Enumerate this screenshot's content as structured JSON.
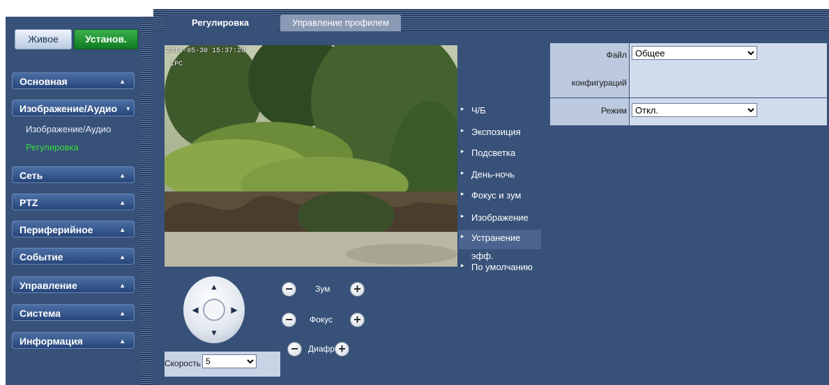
{
  "header": {
    "live_label": "Живое",
    "setup_label": "Установ."
  },
  "sidebar": {
    "items": [
      {
        "label": "Основная",
        "arrow": "▲"
      },
      {
        "label": "Изображение/Аудио",
        "arrow": "▾"
      },
      {
        "label": "Сеть",
        "arrow": "▲"
      },
      {
        "label": "PTZ",
        "arrow": "▲"
      },
      {
        "label": "Периферийное",
        "arrow": "▲"
      },
      {
        "label": "Событие",
        "arrow": "▲"
      },
      {
        "label": "Управление",
        "arrow": "▲"
      },
      {
        "label": "Система",
        "arrow": "▲"
      },
      {
        "label": "Информация",
        "arrow": "▲"
      }
    ],
    "sub_items": [
      {
        "label": "Изображение/Аудио",
        "active": false
      },
      {
        "label": "Регулировка",
        "active": true
      }
    ]
  },
  "tabs": [
    {
      "label": "Регулировка",
      "active": true
    },
    {
      "label": "Управление профилем",
      "active": false
    }
  ],
  "video": {
    "timestamp": "2014-05-30 15:37:20",
    "camera_name": "IPC"
  },
  "ptz": {
    "zoom_label": "Зум",
    "focus_label": "Фокус",
    "iris_label": "Диафр.",
    "minus_symbol": "−",
    "plus_symbol": "+",
    "arrow_up": "▲",
    "arrow_down": "▼",
    "arrow_left": "◀",
    "arrow_right": "▶",
    "speed_label": "Скорость",
    "speed_value": "5"
  },
  "options": {
    "caret": "▸",
    "items": [
      {
        "label": "Ч/Б"
      },
      {
        "label": "Экспозиция"
      },
      {
        "label": "Подсветка"
      },
      {
        "label": "День-ночь"
      },
      {
        "label": "Фокус и зум"
      },
      {
        "label": "Изображение"
      },
      {
        "label": "Устранение"
      },
      {
        "label": "По умолчанию"
      }
    ],
    "active_extra": "эфф."
  },
  "settings": {
    "config_label_1": "Файл",
    "config_label_2": "конфигураций",
    "config_value": "Общее",
    "mode_label": "Режим",
    "mode_value": "Откл."
  },
  "colors": {
    "panel_bg": "#375179",
    "active_green": "#3bdd3b",
    "setup_button": "#0f7b22"
  }
}
